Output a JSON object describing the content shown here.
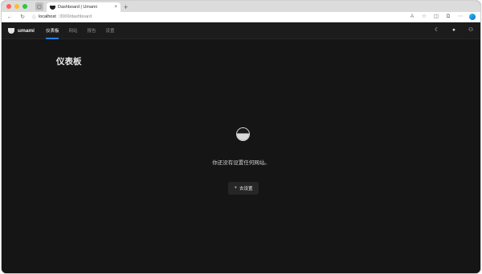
{
  "browser": {
    "tab_title": "Dashboard | Umami",
    "tab_close": "×",
    "new_tab": "+",
    "url_host": "localhost",
    "url_path": ":3000/dashboard",
    "icons": [
      "back-icon",
      "reload-icon",
      "read-aloud-icon",
      "favorite-icon",
      "split-screen-icon",
      "collections-icon",
      "edge-copilot-icon"
    ]
  },
  "header": {
    "brand": "umami",
    "nav": [
      "仪表板",
      "网站",
      "报告",
      "设置"
    ],
    "active_nav": "仪表板",
    "icons": [
      "theme-toggle-icon",
      "language-icon",
      "profile-icon"
    ]
  },
  "main": {
    "title": "仪表板",
    "empty_message": "你还没有设置任何网站。",
    "setup_button": "去设置",
    "setup_icon": "+"
  },
  "colors": {
    "background": "#151515",
    "header": "#1c1c1c",
    "accent": "#2680eb",
    "button": "#262626"
  }
}
